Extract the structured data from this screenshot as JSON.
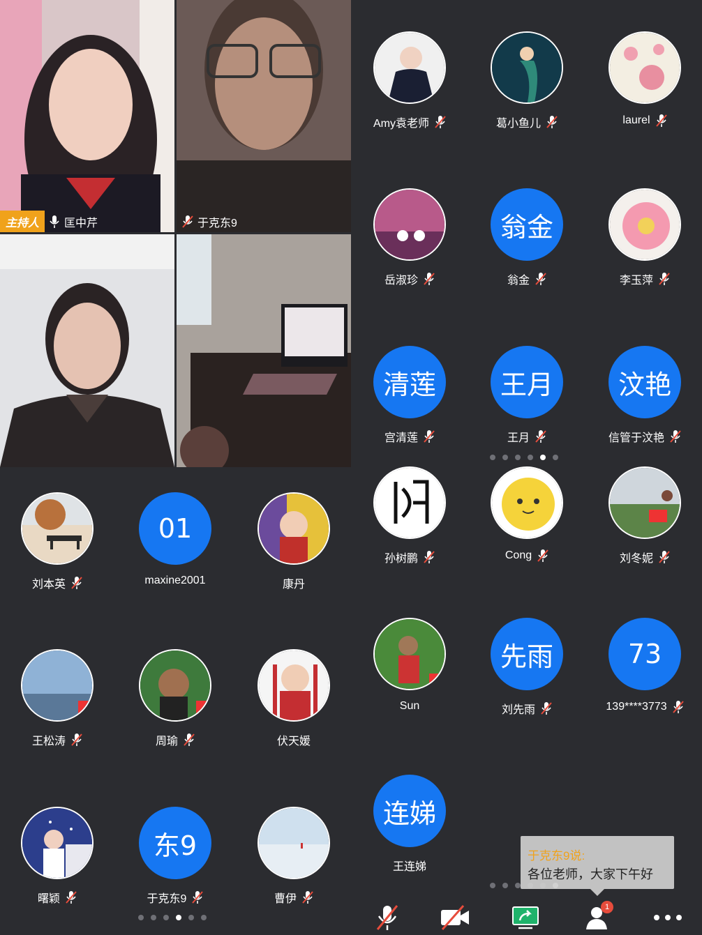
{
  "videos": [
    {
      "badge": "主持人",
      "name": "匡中芹",
      "mic": "on"
    },
    {
      "name": "于克东9",
      "mic": "off"
    },
    {
      "name": "",
      "mic": ""
    },
    {
      "name": "",
      "mic": ""
    }
  ],
  "left_grid": [
    {
      "name": "刘本英",
      "avatar_text": "",
      "photo": "bench"
    },
    {
      "name": "maxine2001",
      "avatar_text": "01",
      "photo": ""
    },
    {
      "name": "康丹",
      "avatar_text": "",
      "photo": "baby"
    },
    {
      "name": "王松涛",
      "avatar_text": "",
      "photo": "sky"
    },
    {
      "name": "周瑜",
      "avatar_text": "",
      "photo": "boy"
    },
    {
      "name": "伏天媛",
      "avatar_text": "",
      "photo": "girl"
    },
    {
      "name": "曙颖",
      "avatar_text": "",
      "photo": "piano"
    },
    {
      "name": "于克东9",
      "avatar_text": "东9",
      "photo": ""
    },
    {
      "name": "曹伊",
      "avatar_text": "",
      "photo": "salt"
    }
  ],
  "right_grid_top": [
    {
      "name": "Amy袁老师",
      "avatar_text": "",
      "photo": "suit"
    },
    {
      "name": "葛小鱼儿",
      "avatar_text": "",
      "photo": "mermaid"
    },
    {
      "name": "laurel",
      "avatar_text": "",
      "photo": "flowers"
    },
    {
      "name": "岳淑珍",
      "avatar_text": "",
      "photo": "swans"
    },
    {
      "name": "翁金",
      "avatar_text": "翁金",
      "photo": ""
    },
    {
      "name": "李玉萍",
      "avatar_text": "",
      "photo": "dahlia"
    },
    {
      "name": "宫清莲",
      "avatar_text": "清莲",
      "photo": ""
    },
    {
      "name": "王月",
      "avatar_text": "王月",
      "photo": ""
    },
    {
      "name": "信管于汶艳",
      "avatar_text": "汶艳",
      "photo": ""
    }
  ],
  "right_grid_bottom": [
    {
      "name": "孙树鹏",
      "avatar_text": "",
      "photo": "calligraphy"
    },
    {
      "name": "Cong",
      "avatar_text": "",
      "photo": "sun"
    },
    {
      "name": "刘冬妮",
      "avatar_text": "",
      "photo": "meadow"
    },
    {
      "name": "Sun",
      "avatar_text": "",
      "photo": "tea"
    },
    {
      "name": "刘先雨",
      "avatar_text": "先雨",
      "photo": ""
    },
    {
      "name": "139****3773",
      "avatar_text": "73",
      "photo": ""
    },
    {
      "name": "王连娣",
      "avatar_text": "连娣",
      "photo": ""
    }
  ],
  "pager": {
    "left_active": 3,
    "left_count": 6,
    "right_mid_active": 4,
    "right_mid_count": 6,
    "right_bot_active": 5,
    "right_bot_count": 6
  },
  "toast": {
    "sender": "于克东9说:",
    "message": "各位老师，大家下午好"
  },
  "toolbar": {
    "participants_badge": "1",
    "icons": [
      "mic-muted-icon",
      "camera-off-icon",
      "share-screen-icon",
      "participants-icon",
      "more-icon"
    ]
  },
  "colors": {
    "accent": "#1677f2",
    "host_badge": "#f0a21b",
    "background": "#2b2c30",
    "muted_red": "#e74c3c"
  }
}
